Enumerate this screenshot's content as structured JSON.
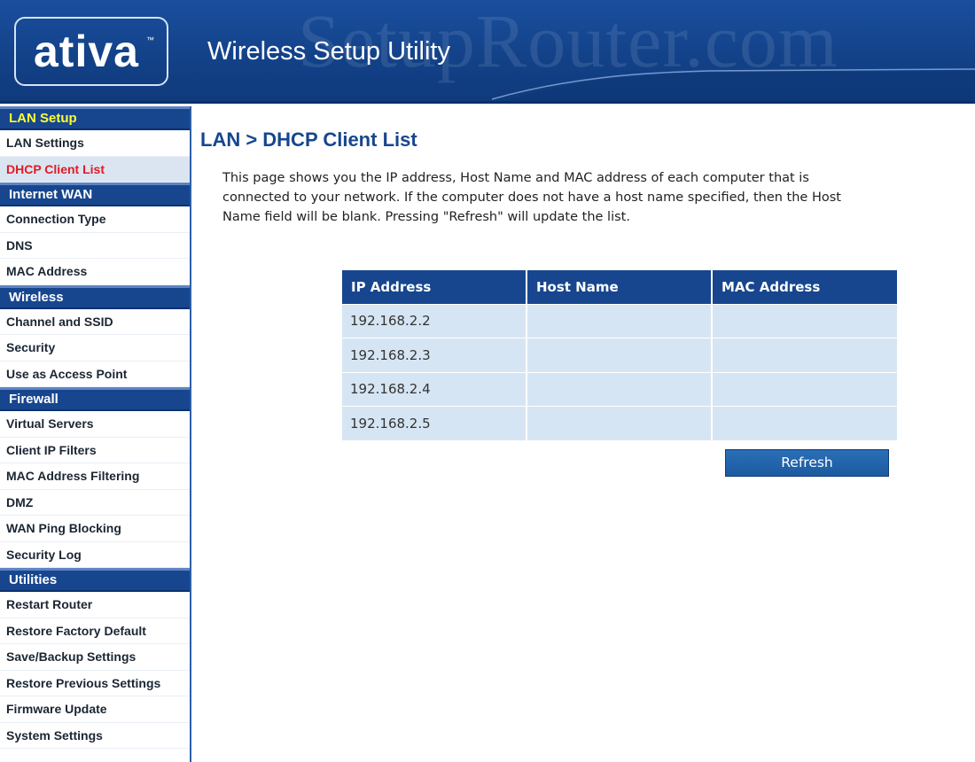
{
  "header": {
    "logo": "ativa",
    "logo_tm": "™",
    "title": "Wireless Setup Utility",
    "watermark": "SetupRouter.com"
  },
  "sidebar": {
    "groups": [
      {
        "label": "LAN Setup",
        "active": true,
        "items": [
          {
            "label": "LAN Settings"
          },
          {
            "label": "DHCP Client List",
            "selected": true
          }
        ]
      },
      {
        "label": "Internet WAN",
        "items": [
          {
            "label": "Connection Type"
          },
          {
            "label": "DNS"
          },
          {
            "label": "MAC Address"
          }
        ]
      },
      {
        "label": "Wireless",
        "items": [
          {
            "label": "Channel and SSID"
          },
          {
            "label": "Security"
          },
          {
            "label": "Use as Access Point"
          }
        ]
      },
      {
        "label": "Firewall",
        "items": [
          {
            "label": "Virtual Servers"
          },
          {
            "label": "Client IP Filters"
          },
          {
            "label": "MAC Address Filtering"
          },
          {
            "label": "DMZ"
          },
          {
            "label": "WAN Ping Blocking"
          },
          {
            "label": "Security Log"
          }
        ]
      },
      {
        "label": "Utilities",
        "items": [
          {
            "label": "Restart Router"
          },
          {
            "label": "Restore Factory Default"
          },
          {
            "label": "Save/Backup Settings"
          },
          {
            "label": "Restore Previous Settings"
          },
          {
            "label": "Firmware Update"
          },
          {
            "label": "System Settings"
          }
        ]
      }
    ]
  },
  "main": {
    "title": "LAN > DHCP Client List",
    "description": "This page shows you the IP address, Host Name and MAC address of each computer that is\nconnected to your network. If the computer does not have a host name specified, then the Host\nName field will be blank. Pressing \"Refresh\" will update the list.",
    "table": {
      "columns": [
        "IP Address",
        "Host Name",
        "MAC Address"
      ],
      "rows": [
        [
          "192.168.2.2",
          "",
          ""
        ],
        [
          "192.168.2.3",
          "",
          ""
        ],
        [
          "192.168.2.4",
          "",
          ""
        ],
        [
          "192.168.2.5",
          "",
          ""
        ]
      ]
    },
    "refresh_label": "Refresh"
  },
  "colors": {
    "brand_blue": "#17468e",
    "row_background": "#d6e5f3",
    "selected_item": "#e01b24",
    "active_group": "#ffff33"
  }
}
